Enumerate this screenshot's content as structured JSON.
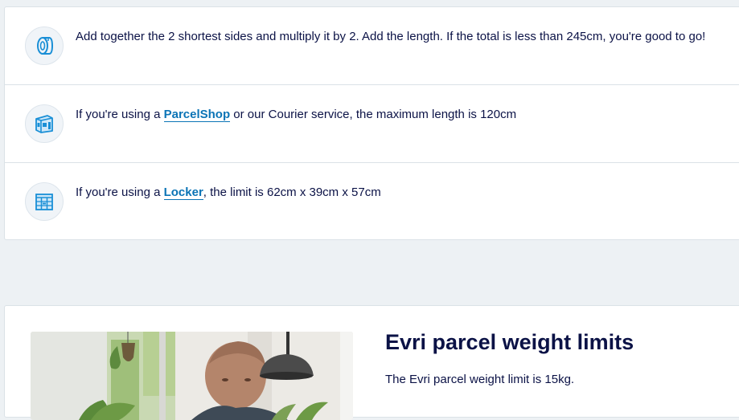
{
  "rules": {
    "size_rule": {
      "icon": "tape-measure-icon",
      "text": "Add together the 2 shortest sides and multiply it by 2. Add the length. If the total is less than 245cm, you're good to go!"
    },
    "parcelshop_rule": {
      "icon": "parcelshop-icon",
      "text_before": "If you're using a ",
      "link_label": "ParcelShop",
      "text_after": " or our Courier service, the maximum length is 120cm"
    },
    "locker_rule": {
      "icon": "locker-icon",
      "text_before": "If you're using a ",
      "link_label": "Locker",
      "text_after": ", the limit is 62cm x 39cm x 57cm"
    }
  },
  "weight_section": {
    "title": "Evri parcel weight limits",
    "description": "The Evri parcel weight limit is 15kg.",
    "image": "man-with-parcel-photo"
  },
  "colors": {
    "page_bg": "#edf1f4",
    "text": "#0b1246",
    "link": "#0b74b6",
    "icon": "#1a8fd6"
  }
}
